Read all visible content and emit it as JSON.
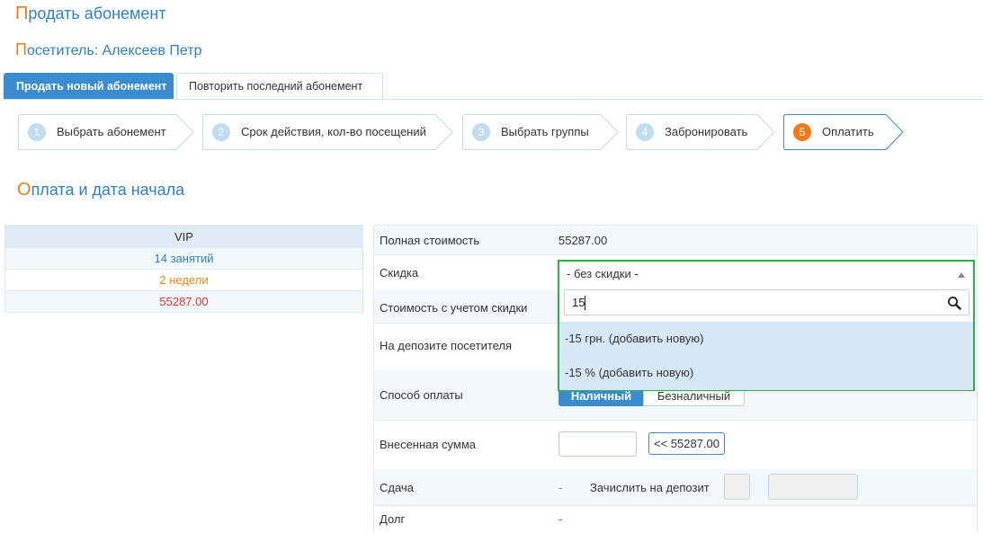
{
  "page": {
    "title": "Продать абонемент",
    "visitor_label": "Посетитель: Алексеев Петр",
    "section_title": "Оплата и дата начала"
  },
  "tabs": [
    {
      "label": "Продать новый абонемент",
      "active": true
    },
    {
      "label": "Повторить последний абонемент",
      "active": false
    }
  ],
  "steps": [
    {
      "num": "1",
      "label": "Выбрать абонемент"
    },
    {
      "num": "2",
      "label": "Срок действия, кол-во посещений"
    },
    {
      "num": "3",
      "label": "Выбрать группы"
    },
    {
      "num": "4",
      "label": "Забронировать"
    },
    {
      "num": "5",
      "label": "Оплатить",
      "current": true
    }
  ],
  "summary": {
    "name": "VIP",
    "lessons": "14 занятий",
    "duration": "2 недели",
    "price": "55287.00"
  },
  "form": {
    "full_price_label": "Полная стоимость",
    "full_price_value": "55287.00",
    "discount_label": "Скидка",
    "discounted_price_label": "Стоимость с учетом скидки",
    "deposit_label": "На депозите посетителя",
    "payment_method_label": "Способ оплаты",
    "payment_cash": "Наличный",
    "payment_cashless": "Безналичный",
    "paid_amount_label": "Внесенная сумма",
    "paid_amount_value": "",
    "fill_amount_button": "<< 55287.00",
    "change_label": "Сдача",
    "change_value": "-",
    "credit_to_deposit_label": "Зачислить на депозит",
    "debt_label": "Долг",
    "debt_value": "-"
  },
  "discount_dropdown": {
    "selected": "- без скидки -",
    "search_value": "15",
    "options": [
      "-15 грн. (добавить новую)",
      "-15 % (добавить новую)"
    ]
  },
  "colors": {
    "accent_blue": "#3a8ccf",
    "orange": "#f07a1a",
    "highlight_green": "#2fae4c",
    "price_red": "#d83a3a"
  }
}
